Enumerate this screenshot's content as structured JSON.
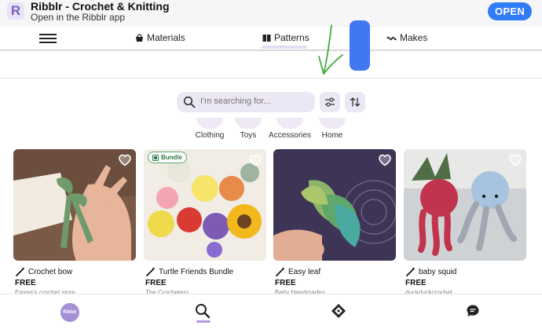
{
  "banner": {
    "app_icon_letter": "R",
    "title": "Ribblr - Crochet & Knitting",
    "subtitle": "Open in the Ribblr app",
    "open_label": "OPEN"
  },
  "nav": {
    "materials": "Materials",
    "patterns": "Patterns",
    "makes": "Makes"
  },
  "search": {
    "placeholder": "I'm searching for..."
  },
  "categories": [
    "Clothing",
    "Toys",
    "Accessories",
    "Home"
  ],
  "cards": [
    {
      "title": "Crochet bow",
      "price": "FREE",
      "store": "Emma's crochet store"
    },
    {
      "title": "Turtle Friends Bundle",
      "price": "FREE",
      "store": "The Crocheters",
      "badge": "Bundle"
    },
    {
      "title": "Easy leaf",
      "price": "FREE",
      "store": "Betty Handmades"
    },
    {
      "title": "baby squid",
      "price": "FREE",
      "store": "duckduckcrochet"
    }
  ],
  "bottom_nav": {
    "home_label": "Ribblr"
  },
  "colors": {
    "accent": "#2f7cf6",
    "lavender": "#ece7f4",
    "brand_purple": "#a58fd6"
  }
}
